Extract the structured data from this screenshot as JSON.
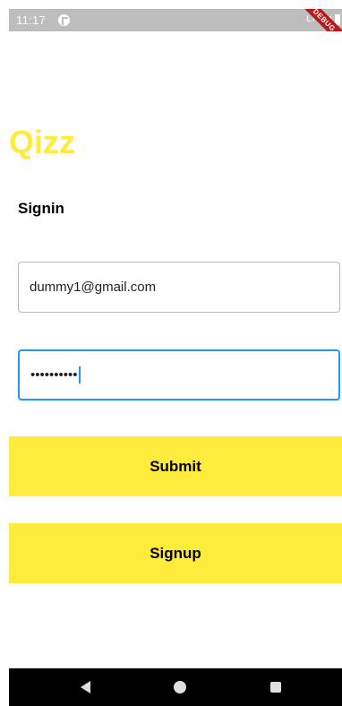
{
  "status_bar": {
    "time": "11:17",
    "network": "LTE",
    "debug_label": "DEBUG"
  },
  "app": {
    "title": "Qizz"
  },
  "form": {
    "heading": "Signin",
    "email_value": "dummy1@gmail.com",
    "password_masked": "••••••••••"
  },
  "buttons": {
    "submit_label": "Submit",
    "signup_label": "Signup"
  },
  "colors": {
    "accent": "#ffeb3b",
    "focus": "#2196f3"
  },
  "icons": {
    "app": "app-notification-icon",
    "signal": "signal-icon",
    "battery": "battery-icon",
    "back": "back-icon",
    "home": "home-icon",
    "recents": "recents-icon"
  }
}
